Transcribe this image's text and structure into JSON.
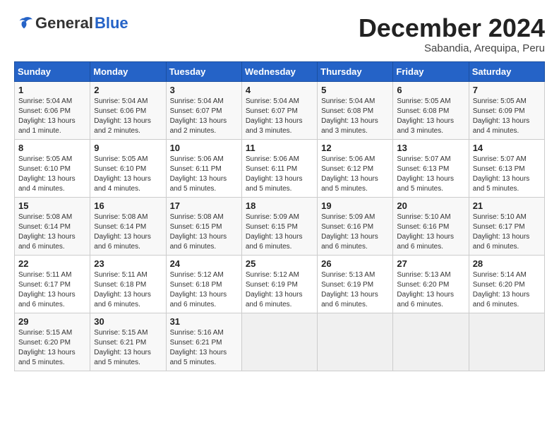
{
  "logo": {
    "general": "General",
    "blue": "Blue"
  },
  "title": {
    "month": "December 2024",
    "location": "Sabandia, Arequipa, Peru"
  },
  "headers": [
    "Sunday",
    "Monday",
    "Tuesday",
    "Wednesday",
    "Thursday",
    "Friday",
    "Saturday"
  ],
  "weeks": [
    [
      {
        "day": "1",
        "info": "Sunrise: 5:04 AM\nSunset: 6:06 PM\nDaylight: 13 hours\nand 1 minute."
      },
      {
        "day": "2",
        "info": "Sunrise: 5:04 AM\nSunset: 6:06 PM\nDaylight: 13 hours\nand 2 minutes."
      },
      {
        "day": "3",
        "info": "Sunrise: 5:04 AM\nSunset: 6:07 PM\nDaylight: 13 hours\nand 2 minutes."
      },
      {
        "day": "4",
        "info": "Sunrise: 5:04 AM\nSunset: 6:07 PM\nDaylight: 13 hours\nand 3 minutes."
      },
      {
        "day": "5",
        "info": "Sunrise: 5:04 AM\nSunset: 6:08 PM\nDaylight: 13 hours\nand 3 minutes."
      },
      {
        "day": "6",
        "info": "Sunrise: 5:05 AM\nSunset: 6:08 PM\nDaylight: 13 hours\nand 3 minutes."
      },
      {
        "day": "7",
        "info": "Sunrise: 5:05 AM\nSunset: 6:09 PM\nDaylight: 13 hours\nand 4 minutes."
      }
    ],
    [
      {
        "day": "8",
        "info": "Sunrise: 5:05 AM\nSunset: 6:10 PM\nDaylight: 13 hours\nand 4 minutes."
      },
      {
        "day": "9",
        "info": "Sunrise: 5:05 AM\nSunset: 6:10 PM\nDaylight: 13 hours\nand 4 minutes."
      },
      {
        "day": "10",
        "info": "Sunrise: 5:06 AM\nSunset: 6:11 PM\nDaylight: 13 hours\nand 5 minutes."
      },
      {
        "day": "11",
        "info": "Sunrise: 5:06 AM\nSunset: 6:11 PM\nDaylight: 13 hours\nand 5 minutes."
      },
      {
        "day": "12",
        "info": "Sunrise: 5:06 AM\nSunset: 6:12 PM\nDaylight: 13 hours\nand 5 minutes."
      },
      {
        "day": "13",
        "info": "Sunrise: 5:07 AM\nSunset: 6:13 PM\nDaylight: 13 hours\nand 5 minutes."
      },
      {
        "day": "14",
        "info": "Sunrise: 5:07 AM\nSunset: 6:13 PM\nDaylight: 13 hours\nand 5 minutes."
      }
    ],
    [
      {
        "day": "15",
        "info": "Sunrise: 5:08 AM\nSunset: 6:14 PM\nDaylight: 13 hours\nand 6 minutes."
      },
      {
        "day": "16",
        "info": "Sunrise: 5:08 AM\nSunset: 6:14 PM\nDaylight: 13 hours\nand 6 minutes."
      },
      {
        "day": "17",
        "info": "Sunrise: 5:08 AM\nSunset: 6:15 PM\nDaylight: 13 hours\nand 6 minutes."
      },
      {
        "day": "18",
        "info": "Sunrise: 5:09 AM\nSunset: 6:15 PM\nDaylight: 13 hours\nand 6 minutes."
      },
      {
        "day": "19",
        "info": "Sunrise: 5:09 AM\nSunset: 6:16 PM\nDaylight: 13 hours\nand 6 minutes."
      },
      {
        "day": "20",
        "info": "Sunrise: 5:10 AM\nSunset: 6:16 PM\nDaylight: 13 hours\nand 6 minutes."
      },
      {
        "day": "21",
        "info": "Sunrise: 5:10 AM\nSunset: 6:17 PM\nDaylight: 13 hours\nand 6 minutes."
      }
    ],
    [
      {
        "day": "22",
        "info": "Sunrise: 5:11 AM\nSunset: 6:17 PM\nDaylight: 13 hours\nand 6 minutes."
      },
      {
        "day": "23",
        "info": "Sunrise: 5:11 AM\nSunset: 6:18 PM\nDaylight: 13 hours\nand 6 minutes."
      },
      {
        "day": "24",
        "info": "Sunrise: 5:12 AM\nSunset: 6:18 PM\nDaylight: 13 hours\nand 6 minutes."
      },
      {
        "day": "25",
        "info": "Sunrise: 5:12 AM\nSunset: 6:19 PM\nDaylight: 13 hours\nand 6 minutes."
      },
      {
        "day": "26",
        "info": "Sunrise: 5:13 AM\nSunset: 6:19 PM\nDaylight: 13 hours\nand 6 minutes."
      },
      {
        "day": "27",
        "info": "Sunrise: 5:13 AM\nSunset: 6:20 PM\nDaylight: 13 hours\nand 6 minutes."
      },
      {
        "day": "28",
        "info": "Sunrise: 5:14 AM\nSunset: 6:20 PM\nDaylight: 13 hours\nand 6 minutes."
      }
    ],
    [
      {
        "day": "29",
        "info": "Sunrise: 5:15 AM\nSunset: 6:20 PM\nDaylight: 13 hours\nand 5 minutes."
      },
      {
        "day": "30",
        "info": "Sunrise: 5:15 AM\nSunset: 6:21 PM\nDaylight: 13 hours\nand 5 minutes."
      },
      {
        "day": "31",
        "info": "Sunrise: 5:16 AM\nSunset: 6:21 PM\nDaylight: 13 hours\nand 5 minutes."
      },
      {
        "day": "",
        "info": ""
      },
      {
        "day": "",
        "info": ""
      },
      {
        "day": "",
        "info": ""
      },
      {
        "day": "",
        "info": ""
      }
    ]
  ]
}
